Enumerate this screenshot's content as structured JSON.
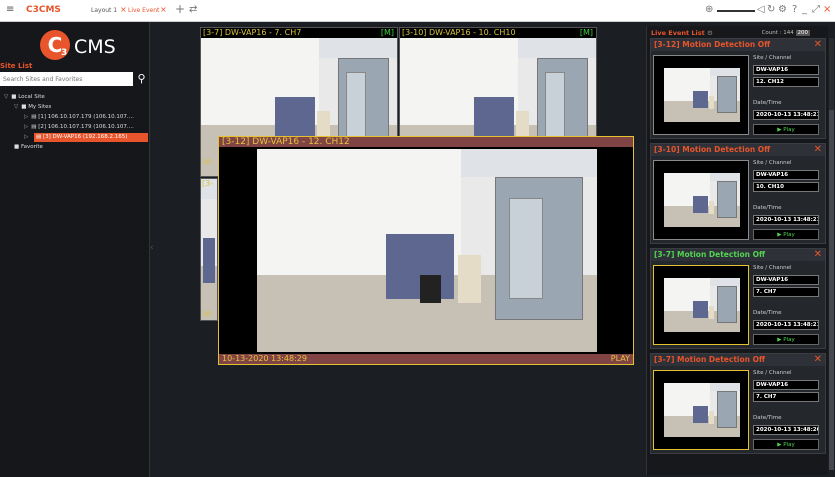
{
  "topbar": {
    "app_name": "C3CMS",
    "tabs": [
      {
        "label": "Layout 1",
        "active": false
      },
      {
        "label": "Live Event",
        "active": true
      }
    ],
    "tab_close": "×",
    "add_tab": "+",
    "swap": "⇄",
    "window_controls": [
      "?",
      "_",
      "⤢",
      "×"
    ]
  },
  "sidebar": {
    "logo_text": "CMS",
    "site_list_title": "Site List",
    "search_placeholder": "Search Sites and Favorites",
    "tree": {
      "local_site": "Local Site",
      "my_sites": "My Sites",
      "items": [
        "[1] 106.10.107.179 (106.10.107....",
        "[2] 106.10.107.179 (106.10.107....",
        "[3] DW-VAP16 (192.168.2.165)"
      ],
      "favorite": "Favorite"
    }
  },
  "cameras": {
    "top_left": {
      "label": "[3-7] DW-VAP16 - 7. CH7",
      "mode": "[M]"
    },
    "top_right": {
      "label": "[3-10] DW-VAP16 - 10. CH10",
      "mode": "[M]"
    },
    "mid_left_fragment": "[3-",
    "bottom_left_fragment": "10-",
    "side_timestamp_fragment": "10-",
    "focused": {
      "label": "[3-12] DW-VAP16 - 12. CH12",
      "timestamp": "10-13-2020 13:48:29",
      "status": "PLAY"
    }
  },
  "event_panel": {
    "title": "Live Event List",
    "count_label": "Count : 144",
    "count_badge": "200",
    "site_channel_label": "Site / Channel",
    "datetime_label": "Date/Time",
    "play_label": "▶  Play",
    "events": [
      {
        "title": "[3-12] Motion Detection Off",
        "site": "DW-VAP16",
        "channel": "12. CH12",
        "datetime": "2020-10-13 13:48:21",
        "highlight": false,
        "title_color": "#e8542b"
      },
      {
        "title": "[3-10] Motion Detection Off",
        "site": "DW-VAP16",
        "channel": "10. CH10",
        "datetime": "2020-10-13 13:48:21",
        "highlight": false,
        "title_color": "#e8542b"
      },
      {
        "title": "[3-7] Motion Detection Off",
        "site": "DW-VAP16",
        "channel": "7. CH7",
        "datetime": "2020-10-13 13:48:21",
        "highlight": true,
        "title_color": "#52d452"
      },
      {
        "title": "[3-7] Motion Detection Off",
        "site": "DW-VAP16",
        "channel": "7. CH7",
        "datetime": "2020-10-13 13:48:20",
        "highlight": true,
        "title_color": "#e8542b"
      }
    ]
  },
  "colors": {
    "accent": "#e8542b",
    "highlight": "#e2c231",
    "ok": "#52d452"
  }
}
